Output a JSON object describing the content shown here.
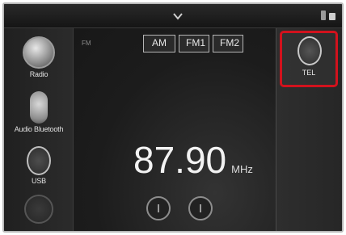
{
  "top_bar": {
    "chevron_icon": "chevron-down-icon"
  },
  "sources": [
    {
      "label": "Radio",
      "icon": "radio-icon"
    },
    {
      "label": "Audio Bluetooth",
      "icon": "bluetooth-audio-icon"
    },
    {
      "label": "USB",
      "icon": "usb-icon"
    },
    {
      "label": "",
      "icon": "source-icon"
    }
  ],
  "bands": {
    "am": "AM",
    "fm1": "FM1",
    "fm2": "FM2"
  },
  "band_indicator": "FM",
  "frequency": {
    "value": "87.90",
    "unit": "MHz"
  },
  "seek": {
    "prev_icon": "seek-previous-icon",
    "next_icon": "seek-next-icon"
  },
  "tel": {
    "label": "TEL",
    "icon": "phone-icon"
  },
  "colors": {
    "highlight": "#d2121d"
  }
}
